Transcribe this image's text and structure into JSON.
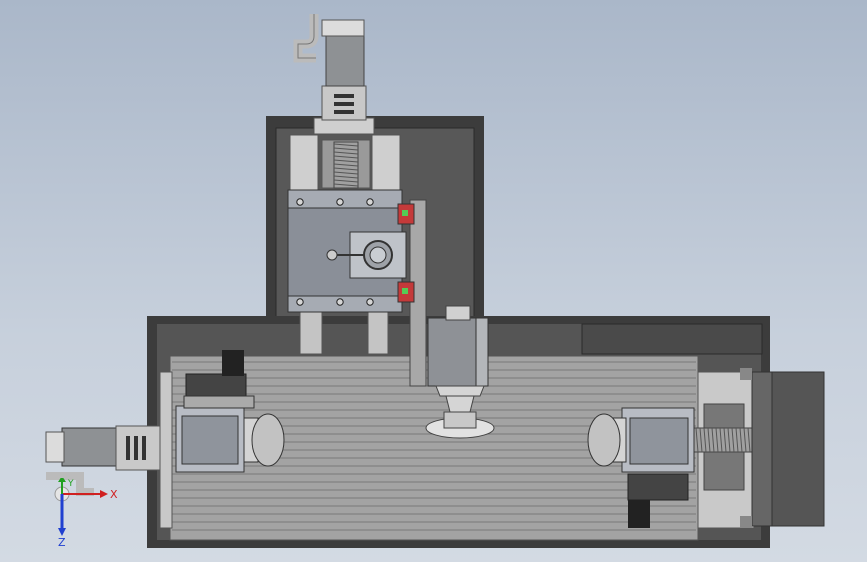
{
  "viewport": {
    "background_top": "#aab7c9",
    "background_bottom": "#d3dae3",
    "frame_color": "#3c3c3c",
    "inner_panel_color": "#5a5a5a",
    "table_color": "#9a9a9a",
    "slot_color": "#7a7a7a",
    "steel_color": "#b8bcc2",
    "accent_color": "#c43a3a",
    "motor_color": "#8f9194"
  },
  "triad": {
    "x_label": "X",
    "y_label": "Y",
    "z_label": "Z",
    "x_color": "#d02020",
    "y_color": "#20a020",
    "z_color": "#2040d0"
  }
}
